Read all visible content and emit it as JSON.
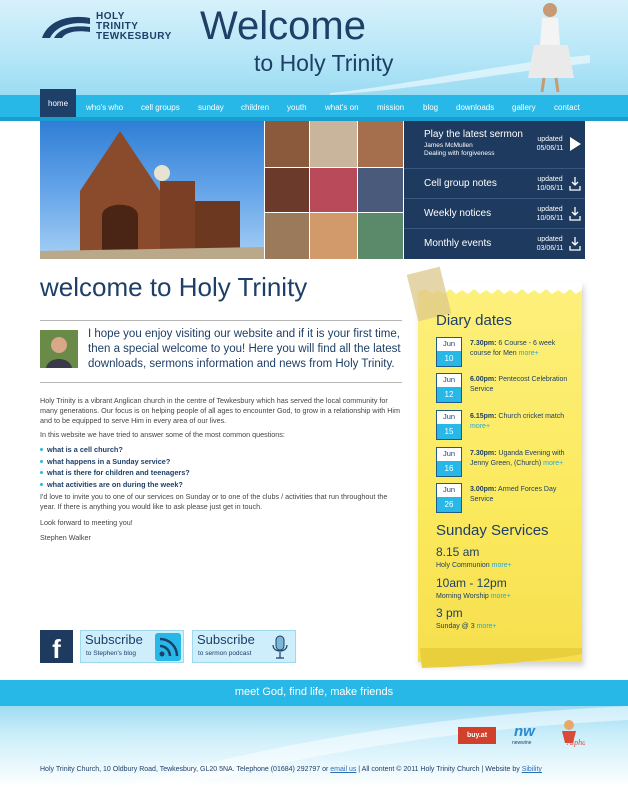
{
  "header": {
    "logo_lines": [
      "HOLY",
      "TRINITY",
      "TEWKESBURY"
    ],
    "welcome": "Welcome",
    "welcome_sub": "to Holy Trinity"
  },
  "nav": {
    "items": [
      "home",
      "who's who",
      "cell groups",
      "sunday",
      "children",
      "youth",
      "what's on",
      "mission",
      "blog",
      "downloads",
      "gallery",
      "contact"
    ],
    "active": "home"
  },
  "banner": {
    "panel": [
      {
        "title": "Play the latest sermon",
        "sub1": "James McMullen",
        "sub2": "Dealing with forgiveness",
        "updated_label": "updated",
        "updated_date": "05/06/11",
        "icon": "play-icon"
      },
      {
        "title": "Cell group notes",
        "updated_label": "updated",
        "updated_date": "10/06/11",
        "icon": "download-icon"
      },
      {
        "title": "Weekly notices",
        "updated_label": "updated",
        "updated_date": "10/06/11",
        "icon": "download-icon"
      },
      {
        "title": "Monthly events",
        "updated_label": "updated",
        "updated_date": "03/06/11",
        "icon": "download-icon"
      }
    ]
  },
  "main": {
    "title": "welcome to Holy Trinity",
    "intro": "I hope you enjoy visiting our website and if it is your first time, then a special welcome to you! Here you will find all the latest downloads, sermons information and news from Holy Trinity.",
    "para1": "Holy Trinity is a vibrant Anglican church in the centre of Tewkesbury which has served the local community for many generations. Our focus is on helping people of all ages to encounter God, to grow in a relationship with Him and to be equipped to serve Him in every area of our lives.",
    "para2": "In this website we have tried to answer some of the most common questions:",
    "questions": [
      "what is a cell church?",
      "what happens in a Sunday service?",
      "what is there for children and teenagers?",
      "what activities are on during the week?"
    ],
    "para3": "I'd love to invite you to one of our services on Sunday or to one of the clubs / activities that run throughout the year. If there is anything you would like to ask please just get in touch.",
    "para4": "Look forward to meeting you!",
    "signature": "Stephen Walker"
  },
  "social": {
    "fb_glyph": "f",
    "blog": {
      "title": "Subscribe",
      "desc": "to Stephen's blog"
    },
    "podcast": {
      "title": "Subscribe",
      "desc": "to sermon podcast"
    }
  },
  "diary": {
    "title": "Diary dates",
    "more_label": "more",
    "events": [
      {
        "month": "Jun",
        "day": "10",
        "time": "7.30pm:",
        "text": "6 Course - 6 week course for Men"
      },
      {
        "month": "Jun",
        "day": "12",
        "time": "6.00pm:",
        "text": "Pentecost Celebration Service"
      },
      {
        "month": "Jun",
        "day": "15",
        "time": "6.15pm:",
        "text": "Church cricket match"
      },
      {
        "month": "Jun",
        "day": "16",
        "time": "7.30pm:",
        "text": "Uganda Evening with Jenny Green, (Church)"
      },
      {
        "month": "Jun",
        "day": "26",
        "time": "3.00pm:",
        "text": "Armed Forces Day Service"
      }
    ]
  },
  "services": {
    "title": "Sunday Services",
    "items": [
      {
        "time": "8.15 am",
        "desc": "Holy Communion"
      },
      {
        "time": "10am - 12pm",
        "desc": "Morning Worship"
      },
      {
        "time": "3 pm",
        "desc": "Sunday @ 3"
      }
    ]
  },
  "footer": {
    "tagline": "meet God, find life, make friends",
    "address": "Holy Trinity Church, 10 Oldbury Road, Tewkesbury, GL20 5NA. Telephone (01684) 292797 or ",
    "email": "email us",
    "copyright": " | All content © 2011 Holy Trinity Church | Website by ",
    "credit": "Sibility",
    "badges": [
      "buy.at",
      "New Wine",
      "Alpha"
    ]
  },
  "colors": {
    "navy": "#1e3f67",
    "cyan": "#27b8e8",
    "panel": "#1e3a5e",
    "note": "#fbe95d"
  }
}
